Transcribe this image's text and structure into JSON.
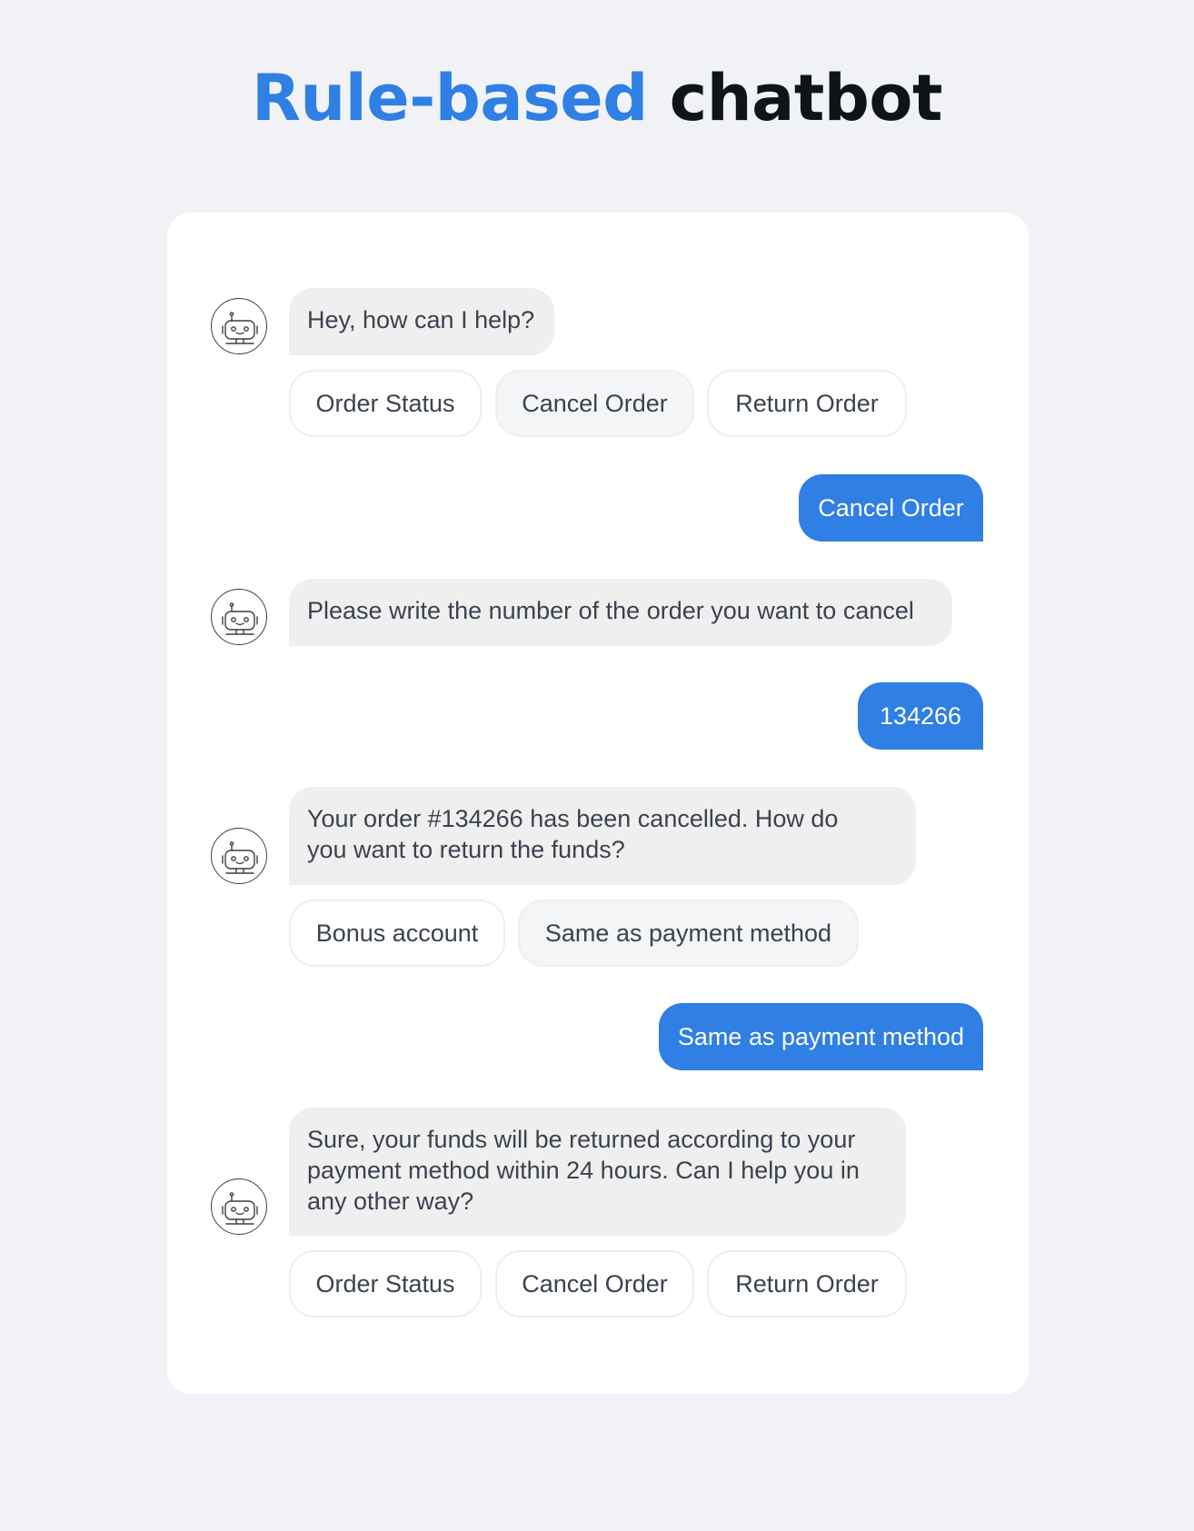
{
  "title": {
    "highlight": "Rule-based",
    "rest": "chatbot"
  },
  "colors": {
    "accent": "#2f7fe4",
    "bot_bubble": "#efefef",
    "background": "#f0f2f5"
  },
  "messages": [
    {
      "from": "bot",
      "icon": "robot-icon",
      "text": "Hey, how can I help?",
      "options": [
        "Order Status",
        "Cancel Order",
        "Return Order"
      ],
      "selected_option": "Cancel Order"
    },
    {
      "from": "user",
      "text": "Cancel Order"
    },
    {
      "from": "bot",
      "icon": "robot-icon",
      "text": "Please write the number of the order you want to cancel"
    },
    {
      "from": "user",
      "text": "134266"
    },
    {
      "from": "bot",
      "icon": "robot-icon",
      "text": "Your order #134266 has been cancelled. How do\nyou want to return the funds?",
      "options": [
        "Bonus account",
        "Same as payment method"
      ],
      "selected_option": "Same as payment method"
    },
    {
      "from": "user",
      "text": "Same as payment method"
    },
    {
      "from": "bot",
      "icon": "robot-icon",
      "text": "Sure, your funds will be returned according to your\npayment method within 24 hours. Can I help you in\nany other way?",
      "options": [
        "Order Status",
        "Cancel Order",
        "Return Order"
      ]
    }
  ]
}
